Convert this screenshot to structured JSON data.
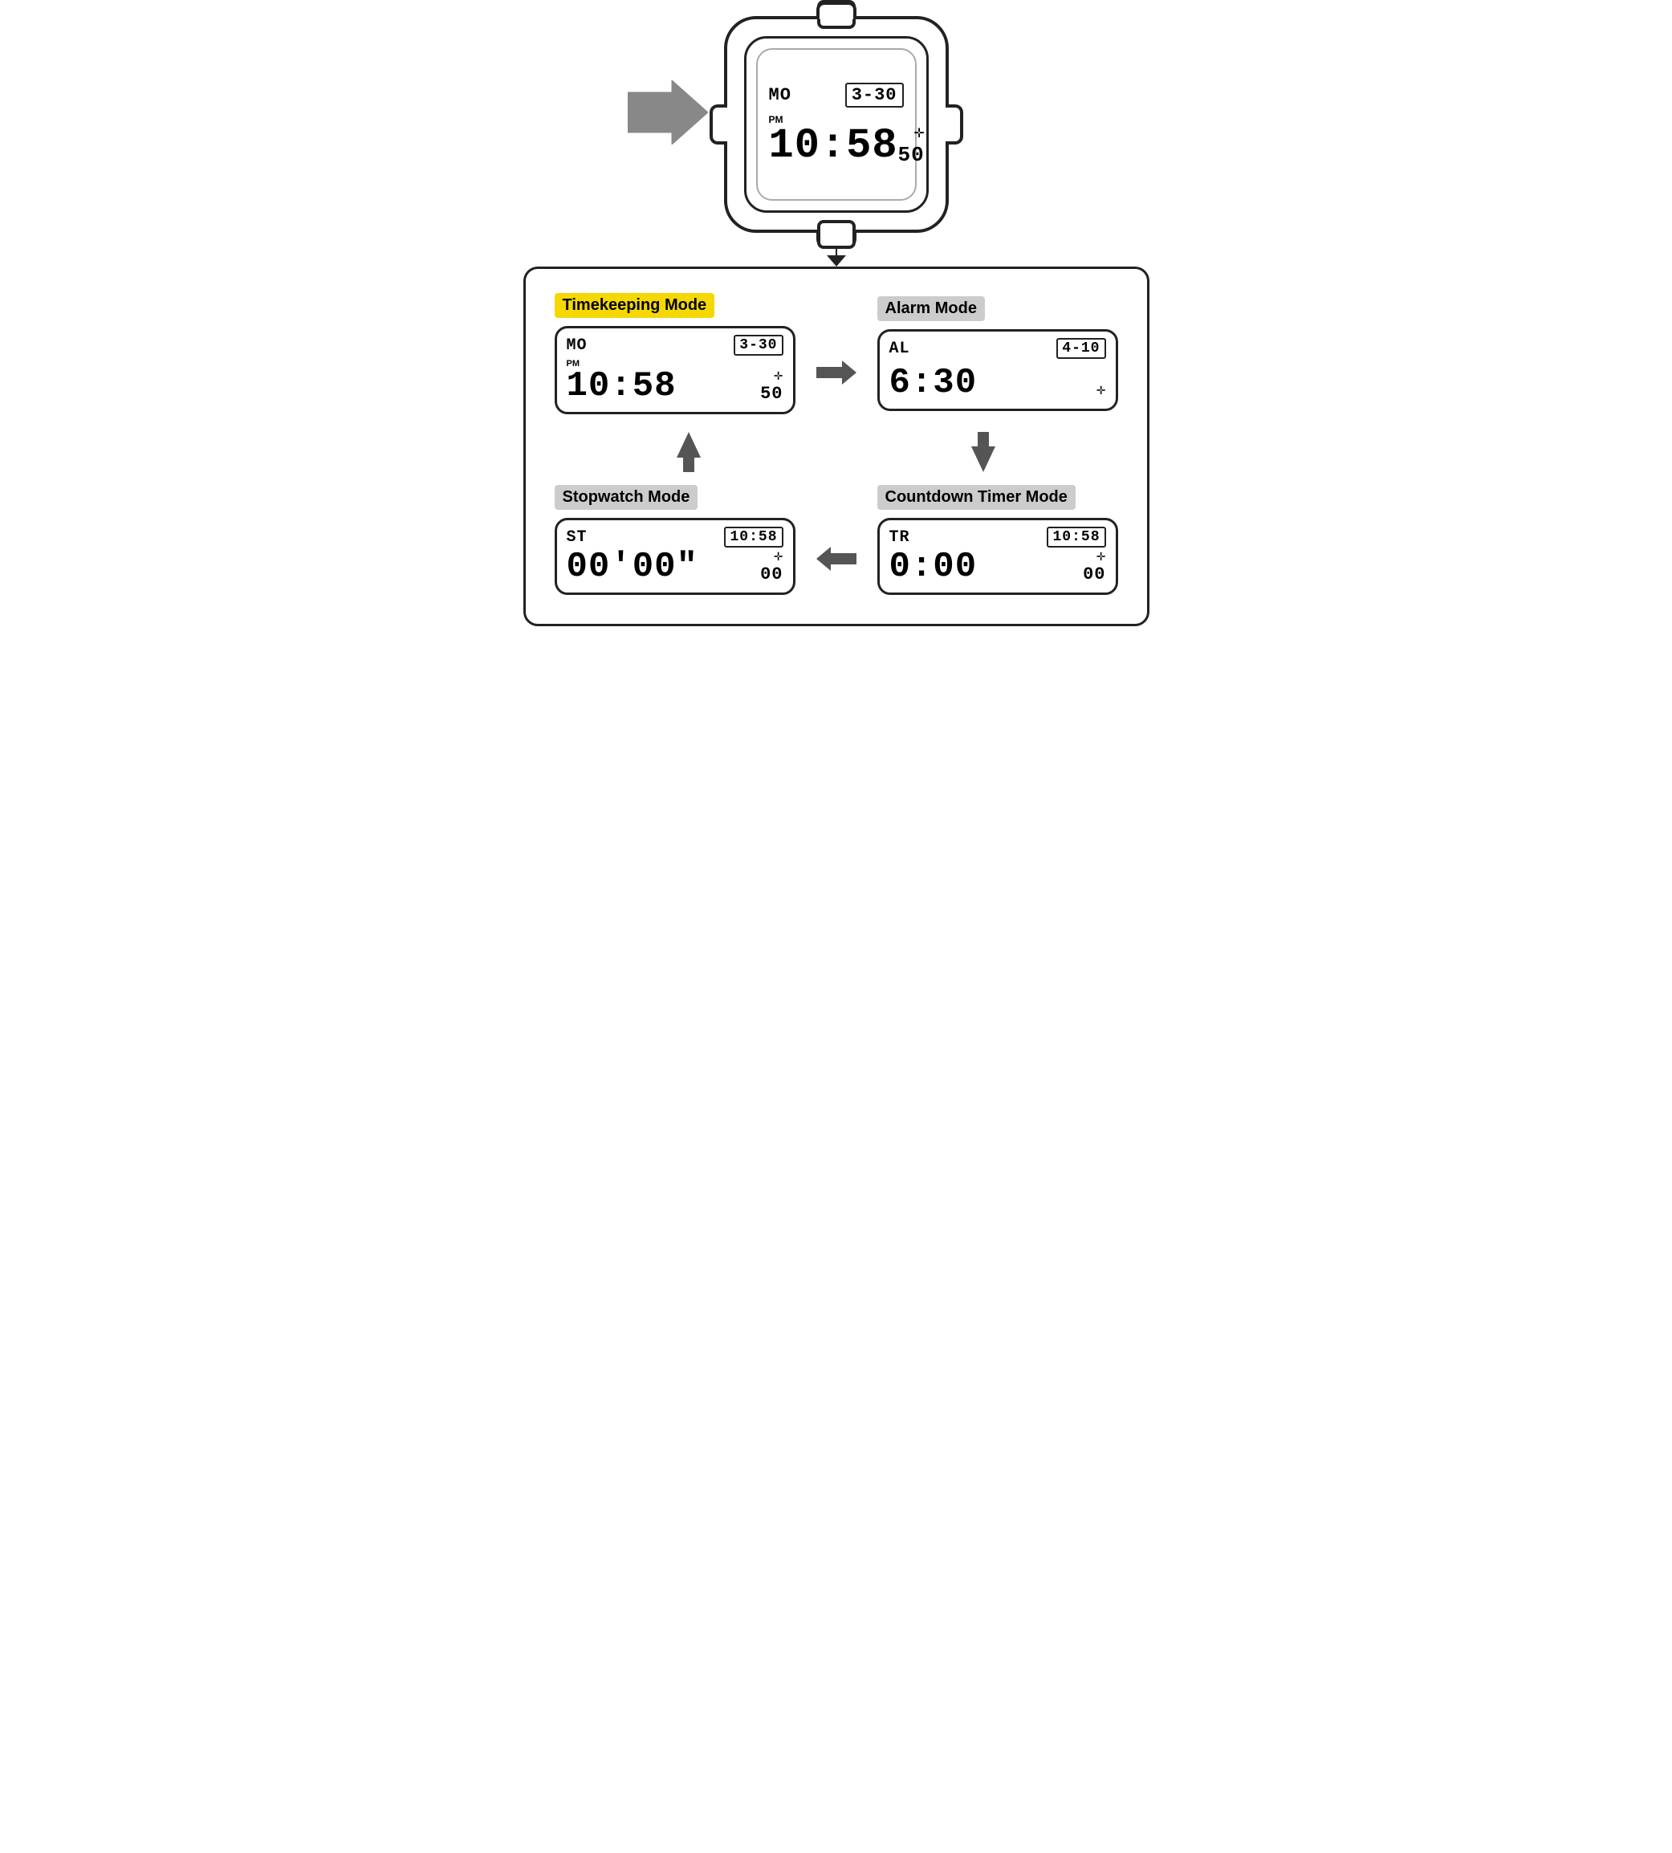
{
  "watch": {
    "top_display": {
      "mode": "MO",
      "date": "3-30",
      "pm": "PM",
      "time": "10:58",
      "seconds": "50",
      "compass": "✛"
    }
  },
  "modes": {
    "timekeeping": {
      "label": "Timekeeping Mode",
      "label_style": "yellow",
      "mode_code": "MO",
      "date": "3-30",
      "pm": "PM",
      "time": "10:58",
      "seconds": "50",
      "compass": "✛"
    },
    "alarm": {
      "label": "Alarm Mode",
      "label_style": "gray",
      "mode_code": "AL",
      "date": "4-10",
      "time": "6:30",
      "compass": "✛"
    },
    "stopwatch": {
      "label": "Stopwatch Mode",
      "label_style": "gray",
      "mode_code": "ST",
      "date": "10:58",
      "time": "00'00\"",
      "seconds": "00",
      "compass": "✛"
    },
    "countdown": {
      "label": "Countdown Timer Mode",
      "label_style": "gray",
      "mode_code": "TR",
      "date": "10:58",
      "time": "0:00",
      "seconds": "00",
      "compass": "✛"
    }
  },
  "arrows": {
    "right": "→",
    "down": "↓",
    "left": "←",
    "up": "↑"
  }
}
